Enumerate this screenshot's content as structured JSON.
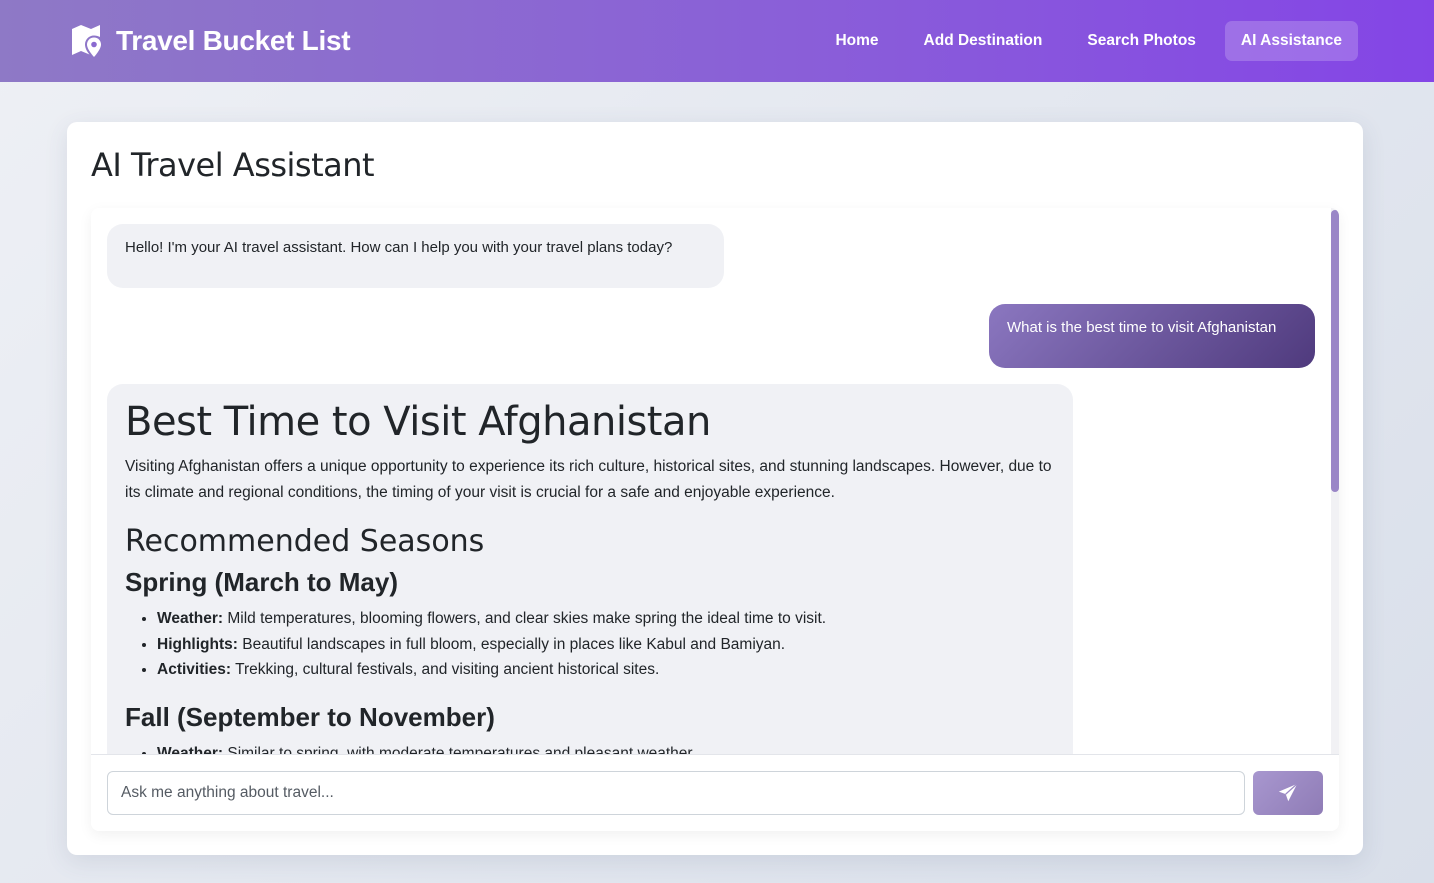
{
  "navbar": {
    "brand": "Travel Bucket List",
    "brand_icon": "map-pin-icon",
    "links": [
      {
        "label": "Home",
        "active": false
      },
      {
        "label": "Add Destination",
        "active": false
      },
      {
        "label": "Search Photos",
        "active": false
      },
      {
        "label": "AI Assistance",
        "active": true
      }
    ]
  },
  "main": {
    "title": "AI Travel Assistant",
    "messages": {
      "greeting": "Hello! I'm your AI travel assistant. How can I help you with your travel plans today?",
      "user_question": "What is the best time to visit Afghanistan",
      "response": {
        "heading": "Best Time to Visit Afghanistan",
        "intro": "Visiting Afghanistan offers a unique opportunity to experience its rich culture, historical sites, and stunning landscapes. However, due to its climate and regional conditions, the timing of your visit is crucial for a safe and enjoyable experience.",
        "section_heading": "Recommended Seasons",
        "spring": {
          "heading": "Spring (March to May)",
          "items": [
            {
              "label": "Weather:",
              "text": " Mild temperatures, blooming flowers, and clear skies make spring the ideal time to visit."
            },
            {
              "label": "Highlights:",
              "text": " Beautiful landscapes in full bloom, especially in places like Kabul and Bamiyan."
            },
            {
              "label": "Activities:",
              "text": " Trekking, cultural festivals, and visiting ancient historical sites."
            }
          ]
        },
        "fall": {
          "heading": "Fall (September to November)",
          "items": [
            {
              "label": "Weather:",
              "text": " Similar to spring, with moderate temperatures and pleasant weather."
            }
          ]
        }
      }
    },
    "input": {
      "placeholder": "Ask me anything about travel...",
      "send_icon": "paper-plane-icon"
    }
  },
  "colors": {
    "accent": "#8a5fd8",
    "user_bubble": "#6b5699",
    "ai_bubble": "#f0f1f5"
  }
}
